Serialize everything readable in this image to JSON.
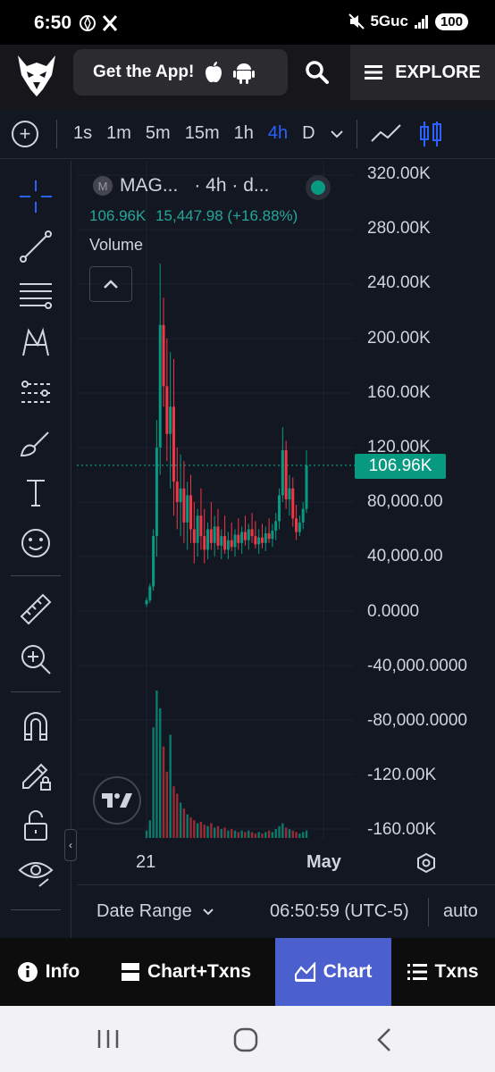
{
  "status_bar": {
    "time": "6:50",
    "network": "5Guc",
    "battery": "100"
  },
  "header": {
    "get_app_label": "Get the App!",
    "explore_label": "EXPLORE"
  },
  "timeframes": [
    "1s",
    "1m",
    "5m",
    "15m",
    "1h",
    "4h",
    "D"
  ],
  "active_timeframe": "4h",
  "legend": {
    "symbol": "MAG...",
    "interval_text": "· 4h · d...",
    "price": "106.96K",
    "change": "15,447.98 (+16.88%)",
    "volume_label": "Volume"
  },
  "price_axis": {
    "labels": [
      "320.00K",
      "280.00K",
      "240.00K",
      "200.00K",
      "160.00K",
      "120.00K",
      "80,000.00",
      "40,000.00",
      "0.0000",
      "-40,000.0000",
      "-80,000.0000",
      "-120.00K",
      "-160.00K"
    ],
    "current_price_tag": "106.96K"
  },
  "time_axis": {
    "labels": [
      "21",
      "May"
    ]
  },
  "bottom_bar": {
    "date_range_label": "Date Range",
    "time_zone": "06:50:59 (UTC-5)",
    "scale_mode": "auto"
  },
  "tabs": [
    {
      "label": "Info",
      "icon": "info-icon",
      "active": false
    },
    {
      "label": "Chart+Txns",
      "icon": "split-layout-icon",
      "active": false
    },
    {
      "label": "Chart",
      "icon": "area-chart-icon",
      "active": true
    },
    {
      "label": "Txns",
      "icon": "list-icon",
      "active": false
    }
  ],
  "colors": {
    "up": "#089981",
    "down": "#f23645",
    "accent": "#2962ff",
    "tab_active": "#4c5fcf"
  },
  "chart_data": {
    "type": "candlestick",
    "title": "",
    "ylim": [
      -160000,
      320000
    ],
    "current_price": 106960,
    "x_ticks": [
      "21",
      "May"
    ],
    "candles_ohlc": [
      [
        5000,
        10000,
        3000,
        8000
      ],
      [
        8000,
        20000,
        6000,
        18000
      ],
      [
        18000,
        60000,
        15000,
        55000
      ],
      [
        55000,
        140000,
        40000,
        120000
      ],
      [
        120000,
        255000,
        100000,
        210000
      ],
      [
        210000,
        230000,
        150000,
        165000
      ],
      [
        165000,
        200000,
        110000,
        130000
      ],
      [
        130000,
        190000,
        90000,
        150000
      ],
      [
        150000,
        185000,
        70000,
        95000
      ],
      [
        95000,
        120000,
        60000,
        80000
      ],
      [
        80000,
        115000,
        55000,
        90000
      ],
      [
        90000,
        110000,
        50000,
        65000
      ],
      [
        65000,
        95000,
        45000,
        85000
      ],
      [
        85000,
        100000,
        50000,
        60000
      ],
      [
        60000,
        80000,
        35000,
        50000
      ],
      [
        50000,
        75000,
        40000,
        70000
      ],
      [
        70000,
        90000,
        45000,
        55000
      ],
      [
        55000,
        75000,
        35000,
        45000
      ],
      [
        45000,
        65000,
        38000,
        60000
      ],
      [
        60000,
        80000,
        45000,
        50000
      ],
      [
        50000,
        70000,
        40000,
        62000
      ],
      [
        62000,
        75000,
        45000,
        48000
      ],
      [
        48000,
        60000,
        38000,
        55000
      ],
      [
        55000,
        70000,
        42000,
        45000
      ],
      [
        45000,
        58000,
        38000,
        52000
      ],
      [
        52000,
        65000,
        44000,
        47000
      ],
      [
        47000,
        60000,
        40000,
        56000
      ],
      [
        56000,
        68000,
        45000,
        50000
      ],
      [
        50000,
        62000,
        42000,
        58000
      ],
      [
        58000,
        70000,
        48000,
        52000
      ],
      [
        52000,
        64000,
        45000,
        60000
      ],
      [
        60000,
        72000,
        50000,
        55000
      ],
      [
        55000,
        66000,
        46000,
        49000
      ],
      [
        49000,
        60000,
        42000,
        54000
      ],
      [
        54000,
        64000,
        46000,
        50000
      ],
      [
        50000,
        62000,
        44000,
        57000
      ],
      [
        57000,
        68000,
        50000,
        53000
      ],
      [
        53000,
        64000,
        47000,
        59000
      ],
      [
        59000,
        72000,
        52000,
        66000
      ],
      [
        66000,
        90000,
        60000,
        85000
      ],
      [
        85000,
        135000,
        80000,
        118000
      ],
      [
        118000,
        125000,
        75000,
        82000
      ],
      [
        82000,
        100000,
        70000,
        90000
      ],
      [
        90000,
        98000,
        62000,
        68000
      ],
      [
        68000,
        78000,
        52000,
        58000
      ],
      [
        58000,
        70000,
        55000,
        65000
      ],
      [
        65000,
        80000,
        60000,
        75000
      ],
      [
        75000,
        118000,
        72000,
        107000
      ]
    ],
    "volume_relative": [
      0.05,
      0.12,
      0.75,
      1.0,
      0.88,
      0.62,
      0.45,
      0.7,
      0.35,
      0.3,
      0.24,
      0.2,
      0.16,
      0.14,
      0.12,
      0.1,
      0.11,
      0.09,
      0.08,
      0.1,
      0.07,
      0.08,
      0.06,
      0.07,
      0.05,
      0.06,
      0.05,
      0.04,
      0.05,
      0.04,
      0.05,
      0.04,
      0.03,
      0.04,
      0.03,
      0.04,
      0.05,
      0.04,
      0.06,
      0.08,
      0.1,
      0.07,
      0.06,
      0.05,
      0.04,
      0.03,
      0.04,
      0.05
    ]
  }
}
